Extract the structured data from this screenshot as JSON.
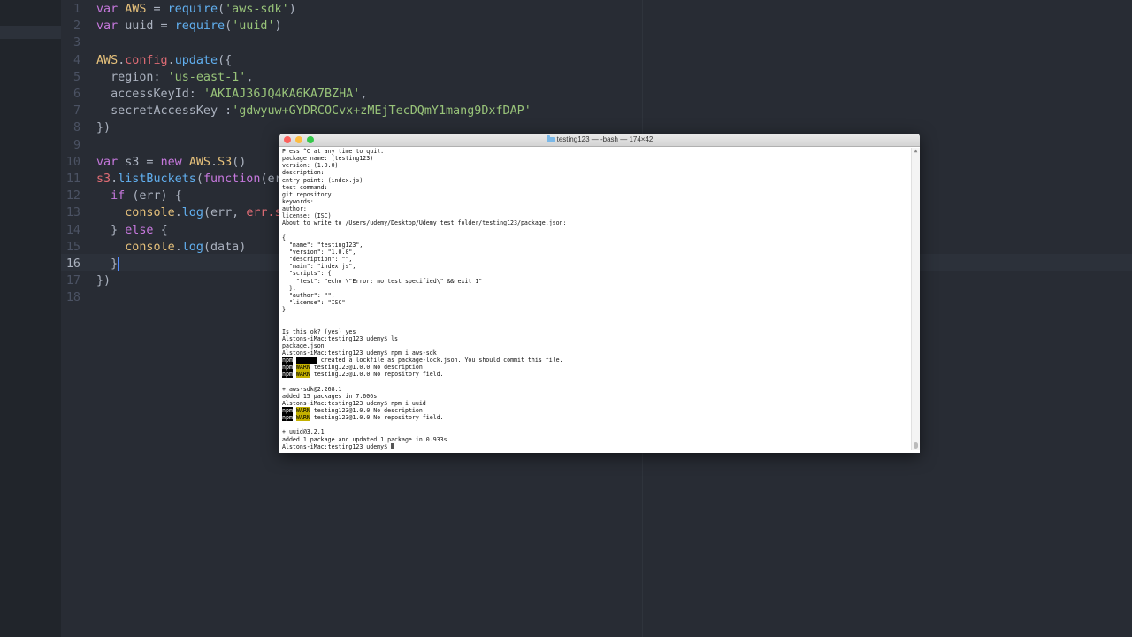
{
  "editor": {
    "active_line": "16",
    "lines": [
      {
        "num": "1",
        "segs": [
          [
            "kw",
            "var "
          ],
          [
            "var",
            "AWS"
          ],
          [
            "plain",
            " = "
          ],
          [
            "fn",
            "require"
          ],
          [
            "plain",
            "("
          ],
          [
            "str",
            "'aws-sdk'"
          ],
          [
            "plain",
            ")"
          ]
        ]
      },
      {
        "num": "2",
        "segs": [
          [
            "kw",
            "var "
          ],
          [
            "plain",
            "uuid = "
          ],
          [
            "fn",
            "require"
          ],
          [
            "plain",
            "("
          ],
          [
            "str",
            "'uuid'"
          ],
          [
            "plain",
            ")"
          ]
        ]
      },
      {
        "num": "3",
        "segs": []
      },
      {
        "num": "4",
        "segs": [
          [
            "var",
            "AWS"
          ],
          [
            "plain",
            "."
          ],
          [
            "prop",
            "config"
          ],
          [
            "plain",
            "."
          ],
          [
            "fn",
            "update"
          ],
          [
            "plain",
            "({"
          ]
        ]
      },
      {
        "num": "5",
        "segs": [
          [
            "plain",
            "  region: "
          ],
          [
            "str",
            "'us-east-1'"
          ],
          [
            "plain",
            ","
          ]
        ]
      },
      {
        "num": "6",
        "segs": [
          [
            "plain",
            "  accessKeyId: "
          ],
          [
            "str",
            "'AKIAJ36JQ4KA6KA7BZHA'"
          ],
          [
            "plain",
            ","
          ]
        ]
      },
      {
        "num": "7",
        "segs": [
          [
            "plain",
            "  secretAccessKey :"
          ],
          [
            "str",
            "'gdwyuw+GYDRCOCvx+zMEjTecDQmY1mang9DxfDAP'"
          ]
        ]
      },
      {
        "num": "8",
        "segs": [
          [
            "plain",
            "})"
          ]
        ]
      },
      {
        "num": "9",
        "segs": []
      },
      {
        "num": "10",
        "segs": [
          [
            "kw",
            "var "
          ],
          [
            "plain",
            "s3 = "
          ],
          [
            "kw",
            "new "
          ],
          [
            "var",
            "AWS"
          ],
          [
            "plain",
            "."
          ],
          [
            "var",
            "S3"
          ],
          [
            "plain",
            "()"
          ]
        ]
      },
      {
        "num": "11",
        "segs": [
          [
            "prop",
            "s3"
          ],
          [
            "plain",
            "."
          ],
          [
            "fn",
            "listBuckets"
          ],
          [
            "plain",
            "("
          ],
          [
            "kw",
            "function"
          ],
          [
            "plain",
            "(err"
          ]
        ]
      },
      {
        "num": "12",
        "segs": [
          [
            "plain",
            "  "
          ],
          [
            "kw",
            "if "
          ],
          [
            "plain",
            "(err) {"
          ]
        ]
      },
      {
        "num": "13",
        "segs": [
          [
            "plain",
            "    "
          ],
          [
            "var",
            "console"
          ],
          [
            "plain",
            "."
          ],
          [
            "fn",
            "log"
          ],
          [
            "plain",
            "(err, "
          ],
          [
            "prop",
            "err.st"
          ]
        ]
      },
      {
        "num": "14",
        "segs": [
          [
            "plain",
            "  } "
          ],
          [
            "kw",
            "else "
          ],
          [
            "plain",
            "{"
          ]
        ]
      },
      {
        "num": "15",
        "segs": [
          [
            "plain",
            "    "
          ],
          [
            "var",
            "console"
          ],
          [
            "plain",
            "."
          ],
          [
            "fn",
            "log"
          ],
          [
            "plain",
            "(data)"
          ]
        ]
      },
      {
        "num": "16",
        "segs": [
          [
            "plain",
            "  }"
          ]
        ]
      },
      {
        "num": "17",
        "segs": [
          [
            "plain",
            "})"
          ]
        ]
      },
      {
        "num": "18",
        "segs": []
      }
    ]
  },
  "terminal": {
    "title": "testing123 — -bash — 174×42",
    "lines": [
      [
        [
          "t",
          "Press ^C at any time to quit."
        ]
      ],
      [
        [
          "t",
          "package name: (testing123)"
        ]
      ],
      [
        [
          "t",
          "version: (1.0.0)"
        ]
      ],
      [
        [
          "t",
          "description:"
        ]
      ],
      [
        [
          "t",
          "entry point: (index.js)"
        ]
      ],
      [
        [
          "t",
          "test command:"
        ]
      ],
      [
        [
          "t",
          "git repository:"
        ]
      ],
      [
        [
          "t",
          "keywords:"
        ]
      ],
      [
        [
          "t",
          "author:"
        ]
      ],
      [
        [
          "t",
          "license: (ISC)"
        ]
      ],
      [
        [
          "t",
          "About to write to /Users/udemy/Desktop/Udemy_test_folder/testing123/package.json:"
        ]
      ],
      [],
      [
        [
          "t",
          "{"
        ]
      ],
      [
        [
          "t",
          "  \"name\": \"testing123\","
        ]
      ],
      [
        [
          "t",
          "  \"version\": \"1.0.0\","
        ]
      ],
      [
        [
          "t",
          "  \"description\": \"\","
        ]
      ],
      [
        [
          "t",
          "  \"main\": \"index.js\","
        ]
      ],
      [
        [
          "t",
          "  \"scripts\": {"
        ]
      ],
      [
        [
          "t",
          "    \"test\": \"echo \\\"Error: no test specified\\\" && exit 1\""
        ]
      ],
      [
        [
          "t",
          "  },"
        ]
      ],
      [
        [
          "t",
          "  \"author\": \"\","
        ]
      ],
      [
        [
          "t",
          "  \"license\": \"ISC\""
        ]
      ],
      [
        [
          "t",
          "}"
        ]
      ],
      [],
      [],
      [
        [
          "t",
          "Is this ok? (yes) yes"
        ]
      ],
      [
        [
          "t",
          "Alstons-iMac:testing123 udemy$ ls"
        ]
      ],
      [
        [
          "t",
          "package.json"
        ]
      ],
      [
        [
          "t",
          "Alstons-iMac:testing123 udemy$ npm i aws-sdk"
        ]
      ],
      [
        [
          "npm",
          "npm"
        ],
        [
          "t",
          " "
        ],
        [
          "notice",
          "notice"
        ],
        [
          "t",
          " created a lockfile as package-lock.json. You should commit this file."
        ]
      ],
      [
        [
          "npm",
          "npm"
        ],
        [
          "t",
          " "
        ],
        [
          "warn",
          "WARN"
        ],
        [
          "t",
          " testing123@1.0.0 No description"
        ]
      ],
      [
        [
          "npm",
          "npm"
        ],
        [
          "t",
          " "
        ],
        [
          "warn",
          "WARN"
        ],
        [
          "t",
          " testing123@1.0.0 No repository field."
        ]
      ],
      [],
      [
        [
          "t",
          "+ aws-sdk@2.268.1"
        ]
      ],
      [
        [
          "t",
          "added 15 packages in 7.606s"
        ]
      ],
      [
        [
          "t",
          "Alstons-iMac:testing123 udemy$ npm i uuid"
        ]
      ],
      [
        [
          "npm",
          "npm"
        ],
        [
          "t",
          " "
        ],
        [
          "warn",
          "WARN"
        ],
        [
          "t",
          " testing123@1.0.0 No description"
        ]
      ],
      [
        [
          "npm",
          "npm"
        ],
        [
          "t",
          " "
        ],
        [
          "warn",
          "WARN"
        ],
        [
          "t",
          " testing123@1.0.0 No repository field."
        ]
      ],
      [],
      [
        [
          "t",
          "+ uuid@3.2.1"
        ]
      ],
      [
        [
          "t",
          "added 1 package and updated 1 package in 0.933s"
        ]
      ],
      [
        [
          "t",
          "Alstons-iMac:testing123 udemy$ "
        ],
        [
          "cursor",
          ""
        ]
      ]
    ]
  }
}
